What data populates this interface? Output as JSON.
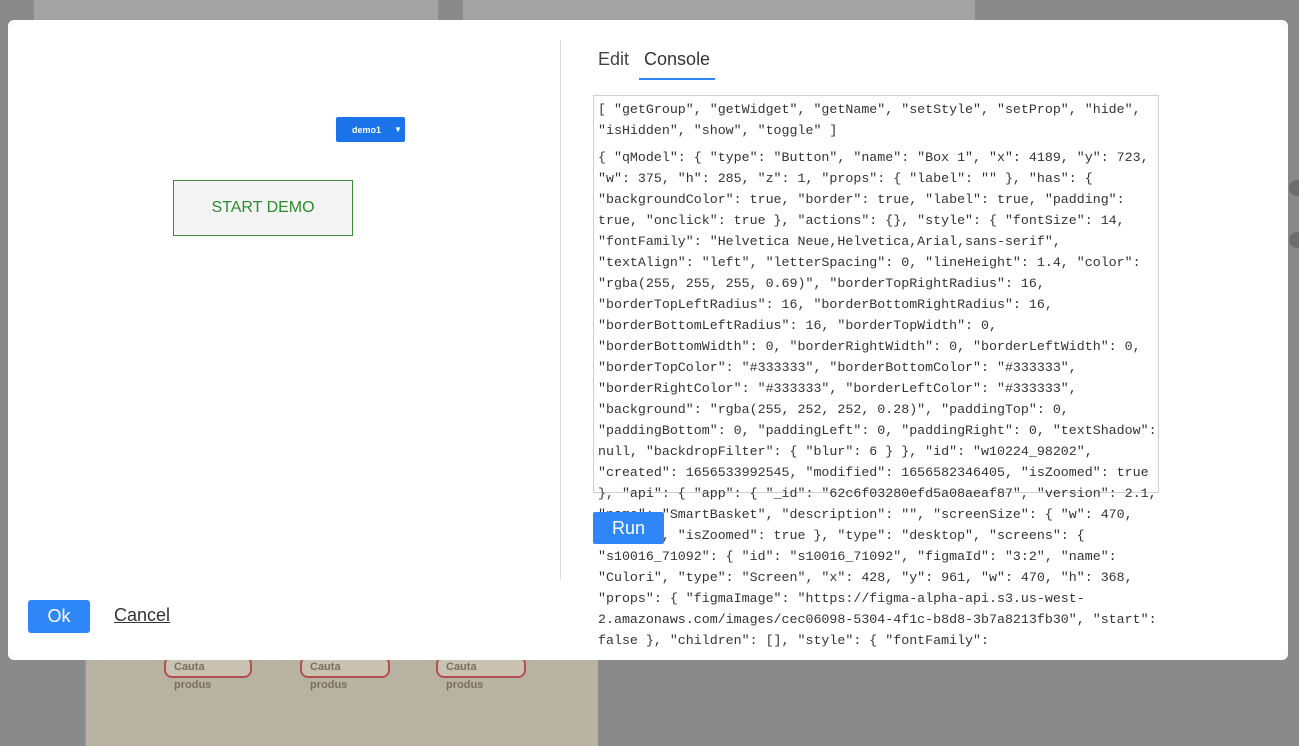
{
  "background": {
    "chips": [
      "Cauta produs",
      "Cauta produs",
      "Cauta produs"
    ]
  },
  "preview": {
    "demo_button": {
      "label": "demo1"
    },
    "start_demo_label": "START DEMO"
  },
  "footer": {
    "ok_label": "Ok",
    "cancel_label": "Cancel"
  },
  "tabs": [
    {
      "label": "Edit",
      "active": false
    },
    {
      "label": "Console",
      "active": true
    }
  ],
  "console": {
    "lines": [
      "[ \"getGroup\", \"getWidget\", \"getName\", \"setStyle\", \"setProp\", \"hide\", \"isHidden\", \"show\", \"toggle\" ]",
      "{ \"qModel\": { \"type\": \"Button\", \"name\": \"Box 1\", \"x\": 4189, \"y\": 723, \"w\": 375, \"h\": 285, \"z\": 1, \"props\": { \"label\": \"\" }, \"has\": { \"backgroundColor\": true, \"border\": true, \"label\": true, \"padding\": true, \"onclick\": true }, \"actions\": {}, \"style\": { \"fontSize\": 14, \"fontFamily\": \"Helvetica Neue,Helvetica,Arial,sans-serif\", \"textAlign\": \"left\", \"letterSpacing\": 0, \"lineHeight\": 1.4, \"color\": \"rgba(255, 255, 255, 0.69)\", \"borderTopRightRadius\": 16, \"borderTopLeftRadius\": 16, \"borderBottomRightRadius\": 16, \"borderBottomLeftRadius\": 16, \"borderTopWidth\": 0, \"borderBottomWidth\": 0, \"borderRightWidth\": 0, \"borderLeftWidth\": 0, \"borderTopColor\": \"#333333\", \"borderBottomColor\": \"#333333\", \"borderRightColor\": \"#333333\", \"borderLeftColor\": \"#333333\", \"background\": \"rgba(255, 252, 252, 0.28)\", \"paddingTop\": 0, \"paddingBottom\": 0, \"paddingLeft\": 0, \"paddingRight\": 0, \"textShadow\": null, \"backdropFilter\": { \"blur\": 6 } }, \"id\": \"w10224_98202\", \"created\": 1656533992545, \"modified\": 1656582346405, \"isZoomed\": true }, \"api\": { \"app\": { \"_id\": \"62c6f03280efd5a08aeaf87\", \"version\": 2.1, \"name\": \"SmartBasket\", \"description\": \"\", \"screenSize\": { \"w\": 470, \"h\": 368, \"isZoomed\": true }, \"type\": \"desktop\", \"screens\": { \"s10016_71092\": { \"id\": \"s10016_71092\", \"figmaId\": \"3:2\", \"name\": \"Culori\", \"type\": \"Screen\", \"x\": 428, \"y\": 961, \"w\": 470, \"h\": 368, \"props\": { \"figmaImage\": \"https://figma-alpha-api.s3.us-west-2.amazonaws.com/images/cec06098-5304-4f1c-b8d8-3b7a8213fb30\", \"start\": false }, \"children\": [], \"style\": { \"fontFamily\":"
    ]
  },
  "run_label": "Run",
  "colors": {
    "accent": "#2f86f6",
    "demo_button": "#1a73e8",
    "start_demo_text": "#2e8a2e"
  }
}
